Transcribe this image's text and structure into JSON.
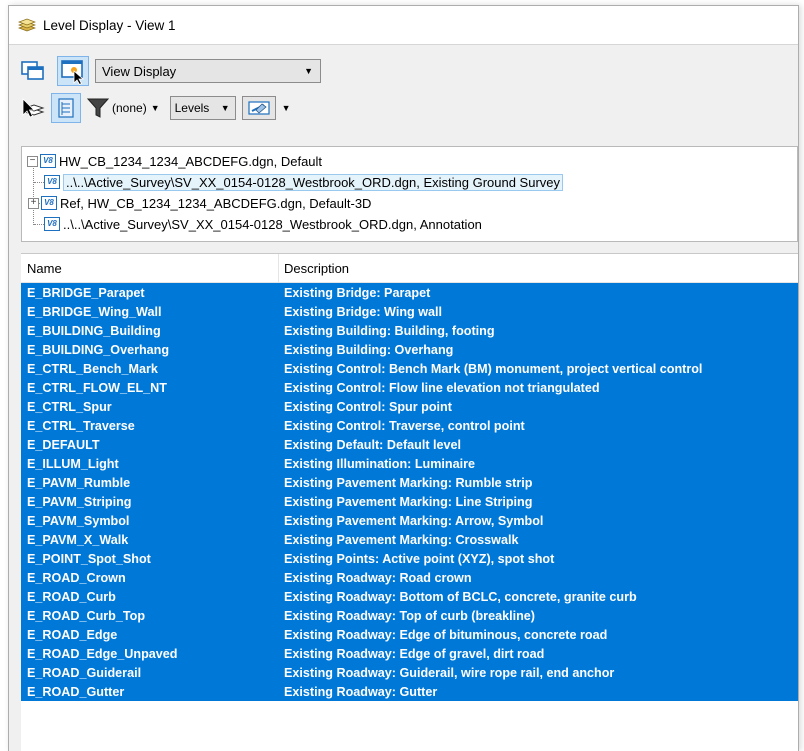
{
  "window": {
    "title": "Level Display - View 1"
  },
  "toolbar": {
    "view_mode": "View Display",
    "filter_value": "(none)",
    "levels_label": "Levels"
  },
  "tree": {
    "root": "HW_CB_1234_1234_ABCDEFG.dgn, Default",
    "children": [
      "..\\..\\Active_Survey\\SV_XX_0154-0128_Westbrook_ORD.dgn, Existing Ground Survey",
      "Ref, HW_CB_1234_1234_ABCDEFG.dgn, Default-3D",
      "..\\..\\Active_Survey\\SV_XX_0154-0128_Westbrook_ORD.dgn, Annotation"
    ]
  },
  "list": {
    "columns": [
      "Name",
      "Description"
    ],
    "rows": [
      [
        "E_BRIDGE_Parapet",
        "Existing Bridge: Parapet"
      ],
      [
        "E_BRIDGE_Wing_Wall",
        "Existing Bridge: Wing wall"
      ],
      [
        "E_BUILDING_Building",
        "Existing Building: Building, footing"
      ],
      [
        "E_BUILDING_Overhang",
        "Existing Building: Overhang"
      ],
      [
        "E_CTRL_Bench_Mark",
        "Existing Control: Bench Mark (BM) monument, project vertical control"
      ],
      [
        "E_CTRL_FLOW_EL_NT",
        "Existing Control: Flow line elevation not triangulated"
      ],
      [
        "E_CTRL_Spur",
        "Existing Control: Spur point"
      ],
      [
        "E_CTRL_Traverse",
        "Existing Control: Traverse, control point"
      ],
      [
        "E_DEFAULT",
        "Existing Default: Default level"
      ],
      [
        "E_ILLUM_Light",
        "Existing Illumination: Luminaire"
      ],
      [
        "E_PAVM_Rumble",
        "Existing Pavement Marking: Rumble strip"
      ],
      [
        "E_PAVM_Striping",
        "Existing Pavement Marking: Line Striping"
      ],
      [
        "E_PAVM_Symbol",
        "Existing Pavement Marking: Arrow, Symbol"
      ],
      [
        "E_PAVM_X_Walk",
        "Existing Pavement Marking: Crosswalk"
      ],
      [
        "E_POINT_Spot_Shot",
        "Existing Points: Active point (XYZ), spot shot"
      ],
      [
        "E_ROAD_Crown",
        "Existing Roadway: Road crown"
      ],
      [
        "E_ROAD_Curb",
        "Existing Roadway: Bottom of BCLC, concrete, granite curb"
      ],
      [
        "E_ROAD_Curb_Top",
        "Existing Roadway: Top of curb (breakline)"
      ],
      [
        "E_ROAD_Edge",
        "Existing Roadway: Edge of bituminous, concrete road"
      ],
      [
        "E_ROAD_Edge_Unpaved",
        "Existing Roadway: Edge of gravel, dirt road"
      ],
      [
        "E_ROAD_Guiderail",
        "Existing Roadway: Guiderail, wire rope rail, end anchor"
      ],
      [
        "E_ROAD_Gutter",
        "Existing Roadway: Gutter"
      ]
    ]
  },
  "colors": {
    "selection": "#0078d7",
    "accent_blue": "#1d6fbf"
  },
  "icons": [
    "level-stack-icon",
    "view-windows-icon",
    "view-select-icon",
    "level-manager-icon",
    "tree-toggle-icon",
    "filter-icon",
    "symbology-icon",
    "v8-file-icon"
  ]
}
